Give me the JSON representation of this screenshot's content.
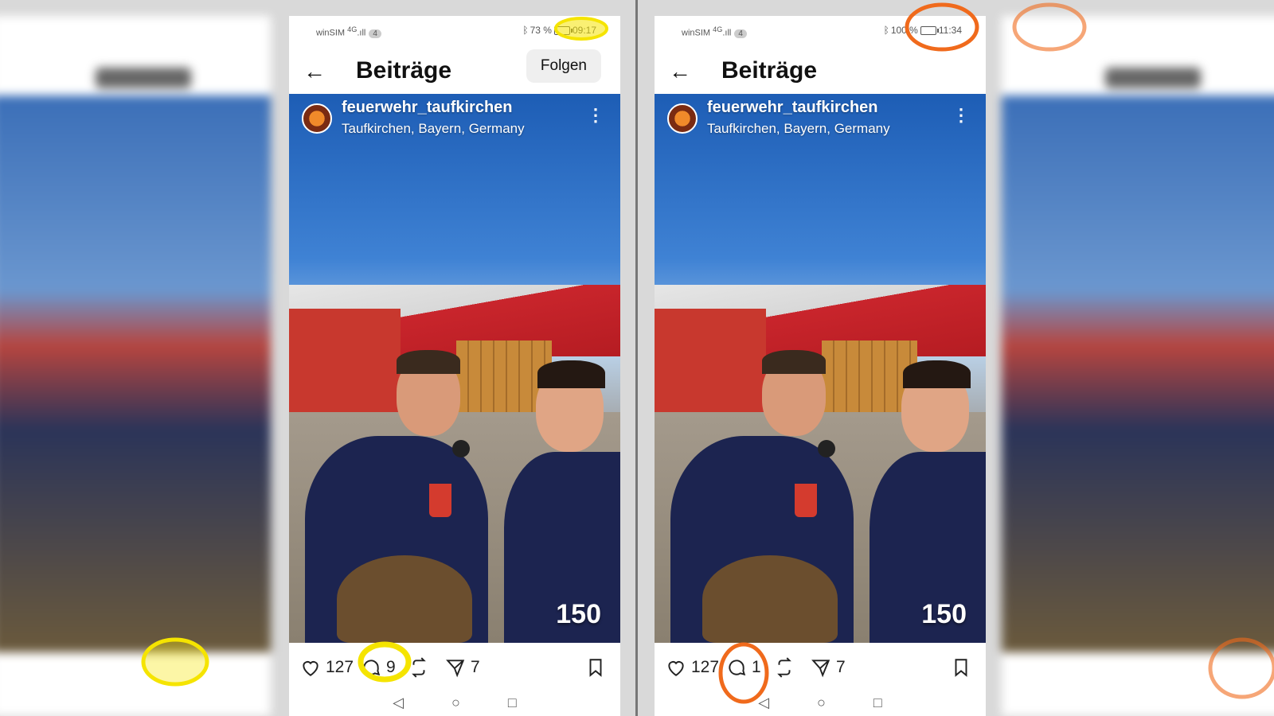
{
  "highlight_colors": {
    "left": "#f5e400",
    "right": "#f06a1c"
  },
  "phones": [
    {
      "status": {
        "carrier": "winSIM",
        "network": "4G",
        "sim": "4",
        "battery": "73 %",
        "time": "09:17"
      },
      "header": {
        "title": "Beiträge",
        "follow_label": "Folgen"
      },
      "post": {
        "username": "feuerwehr_taufkirchen",
        "location": "Taufkirchen, Bayern, Germany",
        "logo": "150"
      },
      "actions": {
        "likes": "127",
        "comments": "9",
        "shares": "7"
      }
    },
    {
      "status": {
        "carrier": "winSIM",
        "network": "4G",
        "sim": "4",
        "battery": "100 %",
        "time": "11:34"
      },
      "header": {
        "title": "Beiträge"
      },
      "post": {
        "username": "feuerwehr_taufkirchen",
        "location": "Taufkirchen, Bayern, Germany",
        "logo": "150"
      },
      "actions": {
        "likes": "127",
        "comments": "1",
        "shares": "7"
      }
    }
  ],
  "nav": {
    "back": "◁",
    "home": "○",
    "recents": "□"
  }
}
